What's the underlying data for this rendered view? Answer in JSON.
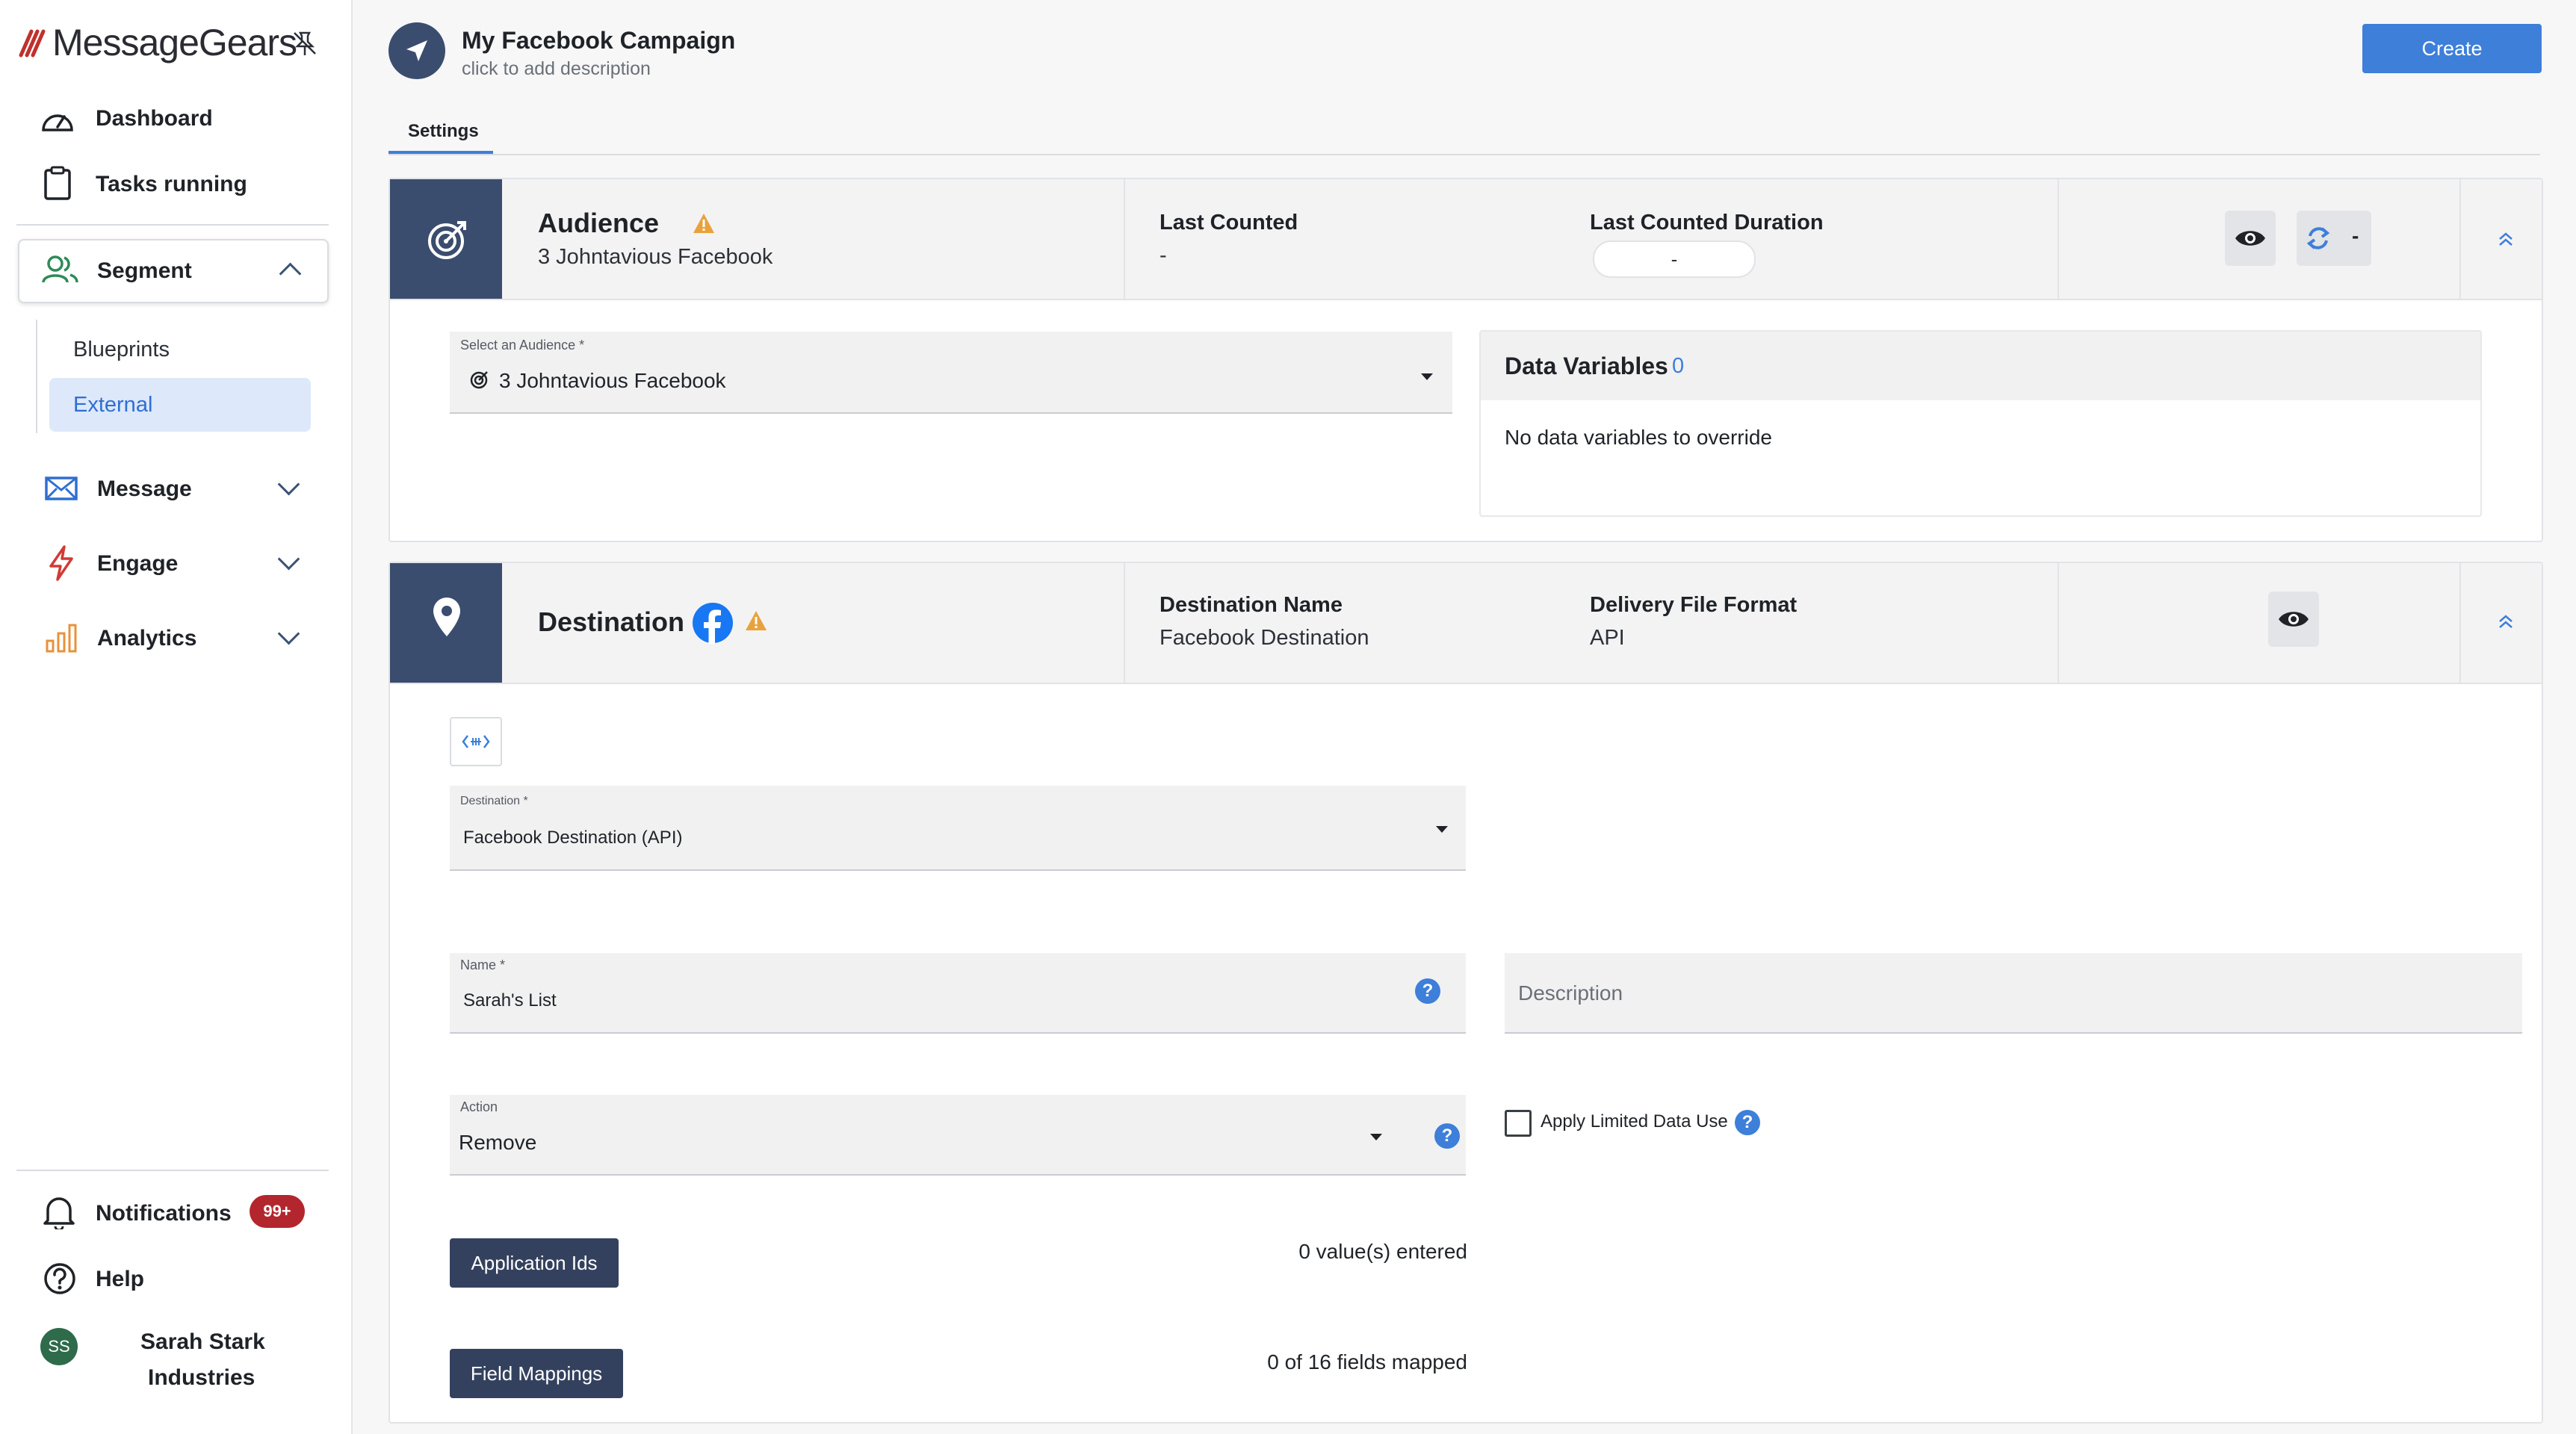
{
  "brand": {
    "name": "MessageGears"
  },
  "sidebar": {
    "top_items": [
      {
        "label": "Dashboard",
        "icon": "dashboard-gauge-icon"
      },
      {
        "label": "Tasks running",
        "icon": "clipboard-icon"
      }
    ],
    "segment": {
      "label": "Segment",
      "icon": "users-icon",
      "children": [
        "Blueprints",
        "External"
      ],
      "selected": "External"
    },
    "sections": [
      {
        "label": "Message",
        "icon": "mail-icon"
      },
      {
        "label": "Engage",
        "icon": "lightning-icon"
      },
      {
        "label": "Analytics",
        "icon": "bar-chart-icon"
      }
    ],
    "notifications": {
      "label": "Notifications",
      "badge": "99+"
    },
    "help": {
      "label": "Help"
    },
    "user": {
      "initials": "SS",
      "org_line1": "Sarah Stark",
      "org_line2": "Industries"
    }
  },
  "header": {
    "title": "My Facebook Campaign",
    "description_placeholder": "click to add description",
    "create_label": "Create",
    "tab": "Settings"
  },
  "audience": {
    "title": "Audience",
    "subtitle": "3 Johntavious Facebook",
    "last_counted_label": "Last Counted",
    "last_counted_value": "-",
    "duration_label": "Last Counted Duration",
    "duration_value": "-",
    "refresh_value": "-",
    "select_label": "Select an Audience *",
    "select_value": "3 Johntavious Facebook",
    "data_vars_title": "Data Variables",
    "data_vars_count": "0",
    "data_vars_empty": "No data variables to override"
  },
  "destination": {
    "title": "Destination",
    "name_label": "Destination Name",
    "name_value": "Facebook Destination",
    "format_label": "Delivery File Format",
    "format_value": "API",
    "dest_field_label": "Destination *",
    "dest_field_value": "Facebook Destination (API)",
    "name_field_label": "Name *",
    "name_field_value": "Sarah's List",
    "description_placeholder": "Description",
    "action_label": "Action",
    "action_value": "Remove",
    "limited_data_label": "Apply Limited Data Use",
    "app_ids_button": "Application Ids",
    "app_ids_status": "0 value(s) entered",
    "field_mappings_button": "Field Mappings",
    "field_mappings_status": "0 of 16 fields mapped"
  },
  "colors": {
    "accent_blue": "#3d7fd9",
    "navy": "#3b4d6e",
    "badge_red": "#b3262e",
    "warning": "#e9a23b",
    "facebook": "#1877f2"
  }
}
